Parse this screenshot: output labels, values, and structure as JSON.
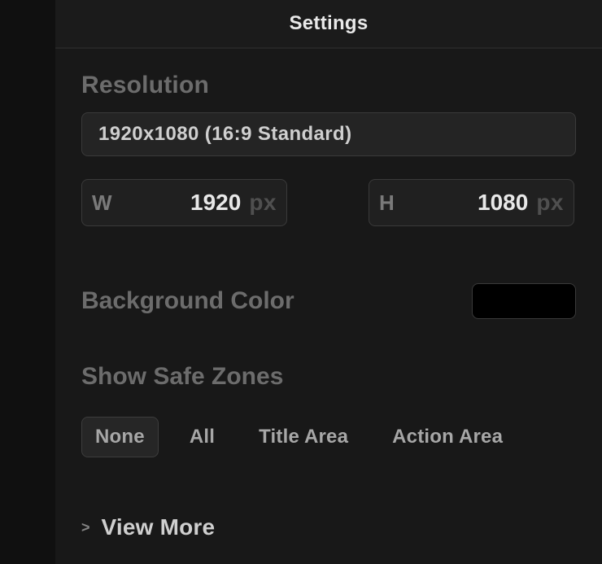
{
  "header": {
    "title": "Settings"
  },
  "resolution": {
    "label": "Resolution",
    "select_value": "1920x1080 (16:9 Standard)",
    "width_label": "W",
    "width_value": "1920",
    "width_unit": "px",
    "height_label": "H",
    "height_value": "1080",
    "height_unit": "px"
  },
  "background": {
    "label": "Background Color",
    "color": "#000000"
  },
  "safe_zones": {
    "label": "Show Safe Zones",
    "options": {
      "none": "None",
      "all": "All",
      "title_area": "Title Area",
      "action_area": "Action Area"
    },
    "selected": "none"
  },
  "view_more": {
    "chevron": ">",
    "label": "View More"
  }
}
